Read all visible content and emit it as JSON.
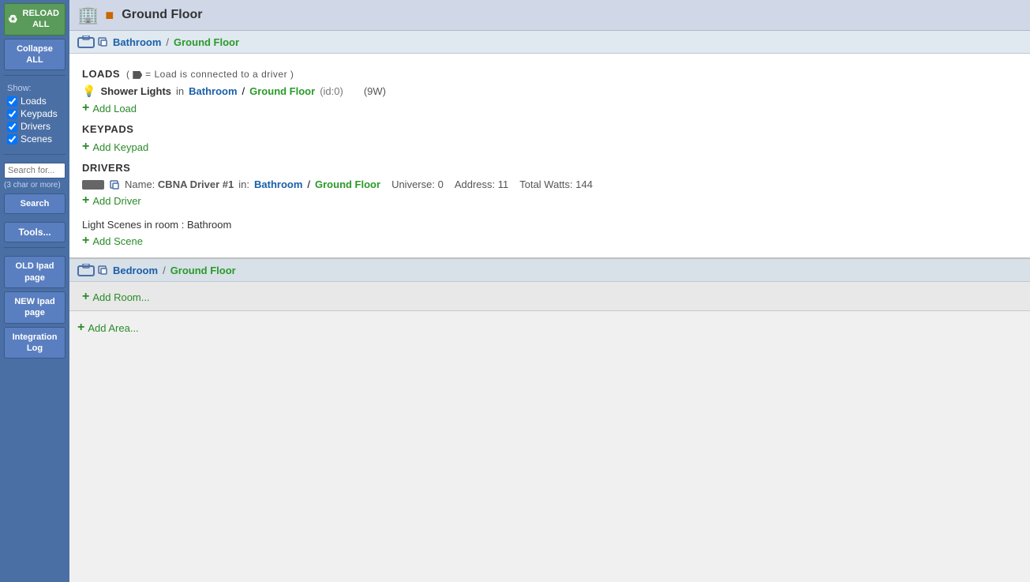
{
  "sidebar": {
    "reload_label": "RELOAD ALL",
    "collapse_label": "Collapse ALL",
    "show_label": "Show:",
    "show_items": [
      {
        "label": "Loads",
        "checked": true
      },
      {
        "label": "Keypads",
        "checked": true
      },
      {
        "label": "Drivers",
        "checked": true
      },
      {
        "label": "Scenes",
        "checked": true
      }
    ],
    "search_placeholder": "Search for...",
    "search_hint": "(3 char or more)",
    "search_btn": "Search",
    "tools_btn": "Tools...",
    "old_ipad_label": "OLD Ipad page",
    "new_ipad_label": "NEW Ipad page",
    "integration_label": "Integration Log"
  },
  "header": {
    "floor_name": "Ground Floor"
  },
  "bathroom": {
    "room_link": "Bathroom",
    "sep": "/",
    "floor_link": "Ground Floor",
    "loads_header": "LOADS",
    "loads_hint_1": "(",
    "loads_hint_tag": "tag",
    "loads_hint_2": "= Load is connected to a driver )",
    "load": {
      "name": "Shower Lights",
      "in_text": "in",
      "room_link": "Bathroom",
      "sep": "/",
      "floor_link": "Ground Floor",
      "id_text": "(id:0)",
      "watts": "(9W)"
    },
    "add_load": "Add Load",
    "keypads_header": "KEYPADS",
    "add_keypad": "Add Keypad",
    "drivers_header": "DRIVERS",
    "driver": {
      "name_label": "Name:",
      "driver_name": "CBNA Driver #1",
      "in_text": "in:",
      "room_link": "Bathroom",
      "sep": "/",
      "floor_link": "Ground Floor",
      "universe": "Universe: 0",
      "address": "Address: 11",
      "total_watts": "Total Watts: 144"
    },
    "add_driver": "Add Driver",
    "scenes_title": "Light Scenes in room : Bathroom",
    "add_scene": "Add Scene"
  },
  "bedroom": {
    "room_link": "Bedroom",
    "sep": "/",
    "floor_link": "Ground Floor",
    "add_room": "Add Room..."
  },
  "add_area": "Add Area..."
}
